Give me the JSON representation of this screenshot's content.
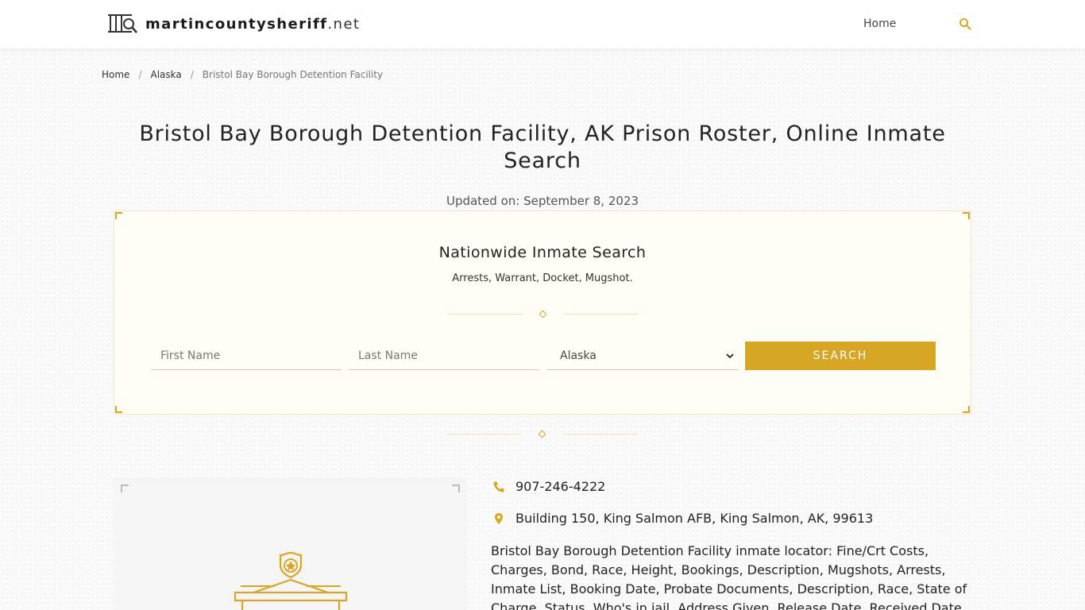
{
  "site": {
    "logo_name": "martincountysheriff",
    "logo_tld": ".net",
    "nav_home": "Home"
  },
  "breadcrumb": {
    "items": [
      "Home",
      "Alaska",
      "Bristol Bay Borough Detention Facility"
    ]
  },
  "page": {
    "title": "Bristol Bay Borough Detention Facility, AK Prison Roster, Online Inmate Search",
    "updated": "Updated on: September 8, 2023"
  },
  "search": {
    "title": "Nationwide Inmate Search",
    "subtitle": "Arrests, Warrant, Docket, Mugshot.",
    "first_placeholder": "First Name",
    "last_placeholder": "Last Name",
    "state_value": "Alaska",
    "button_label": "SEARCH"
  },
  "facility": {
    "phone": "907-246-4222",
    "address": "Building 150, King Salmon AFB, King Salmon, AK, 99613",
    "description": "Bristol Bay Borough Detention Facility inmate locator: Fine/Crt Costs, Charges, Bond, Race, Height, Bookings, Description, Mugshots, Arrests, Inmate List, Booking Date, Probate Documents, Description, Race, State of Charge, Status, Who's in jail, Address Given, Release Date, Received Date"
  },
  "colors": {
    "accent": "#d8a625",
    "box_background": "#fffdf6"
  },
  "icons": [
    "jail-bars-search-icon",
    "search-icon",
    "chevron-down-icon",
    "phone-icon",
    "map-pin-icon",
    "building-badge-icon"
  ]
}
